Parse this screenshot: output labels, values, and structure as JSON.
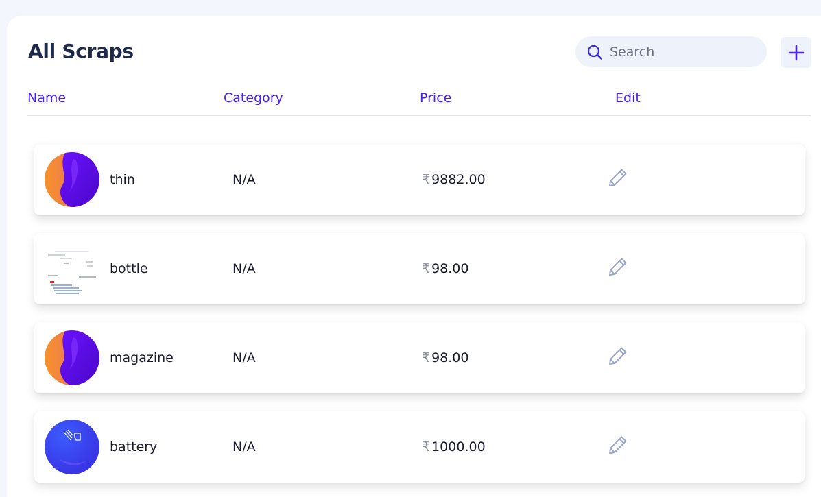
{
  "page": {
    "title": "All Scraps"
  },
  "search": {
    "placeholder": "Search",
    "value": ""
  },
  "toolbar": {
    "add_label": "+"
  },
  "columns": [
    "Name",
    "Category",
    "Price",
    "Edit"
  ],
  "currency_symbol": "₹",
  "rows": [
    {
      "name": "thin",
      "category": "N/A",
      "price": "9882.00",
      "thumbnail": "gradient-avatar"
    },
    {
      "name": "bottle",
      "category": "N/A",
      "price": "98.00",
      "thumbnail": "document-image"
    },
    {
      "name": "magazine",
      "category": "N/A",
      "price": "98.00",
      "thumbnail": "gradient-avatar"
    },
    {
      "name": "battery",
      "category": "N/A",
      "price": "1000.00",
      "thumbnail": "blue-logo"
    }
  ],
  "colors": {
    "accent": "#4a1ff0",
    "title": "#1e2a4a",
    "background": "#f3f6fd",
    "search_bg": "#eef2fb",
    "edit_icon": "#9aa6c8"
  },
  "icons": {
    "search": "search-icon",
    "add": "plus-icon",
    "edit": "pencil-icon"
  }
}
